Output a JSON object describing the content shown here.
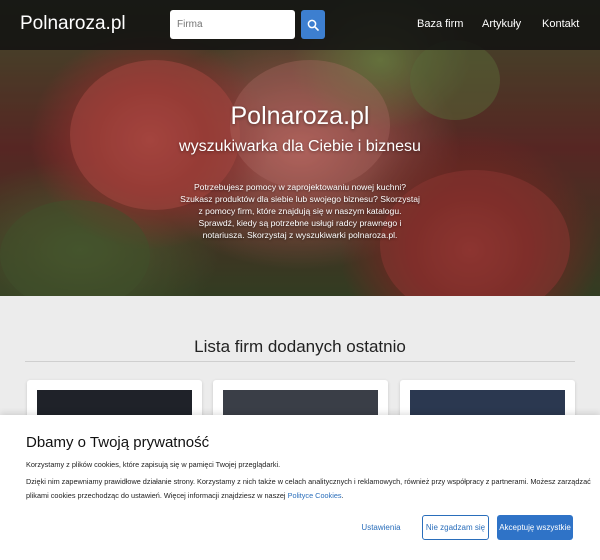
{
  "navbar": {
    "brand": "Polnaroza.pl",
    "search_placeholder": "Firma",
    "links": [
      "Baza firm",
      "Artykuły",
      "Kontakt"
    ]
  },
  "hero": {
    "title": "Polnaroza.pl",
    "subtitle": "wyszukiwarka dla Ciebie i biznesu",
    "description": "Potrzebujesz pomocy w zaprojektowaniu nowej kuchni? Szukasz produktów dla siebie lub swojego biznesu? Skorzystaj z pomocy firm, które znajdują się w naszym katalogu. Sprawdź, kiedy są potrzebne usługi radcy prawnego i notariusza. Skorzystaj z wyszukiwarki polnaroza.pl."
  },
  "main": {
    "section_title": "Lista firm dodanych ostatnio"
  },
  "cookie": {
    "title": "Dbamy o Twoją prywatność",
    "line1": "Korzystamy z plików cookies, które zapisują się w pamięci Twojej przeglądarki.",
    "line2": "Dzięki nim zapewniamy prawidłowe działanie strony. Korzystamy z nich także w celach analitycznych i reklamowych, również przy współpracy z partnerami. Możesz zarządzać",
    "line3": "plikami cookies przechodząc do ustawień. Więcej informacji znajdziesz w naszej",
    "link": "Polityce Cookies",
    "line3_end": ".",
    "btn_settings": "Ustawienia",
    "btn_reject": "Nie zgadzam się",
    "btn_accept": "Akceptuję wszystkie"
  },
  "colors": {
    "accent": "#2f73c7",
    "navbar": "#121212"
  },
  "icons": {
    "search": "search-icon"
  }
}
